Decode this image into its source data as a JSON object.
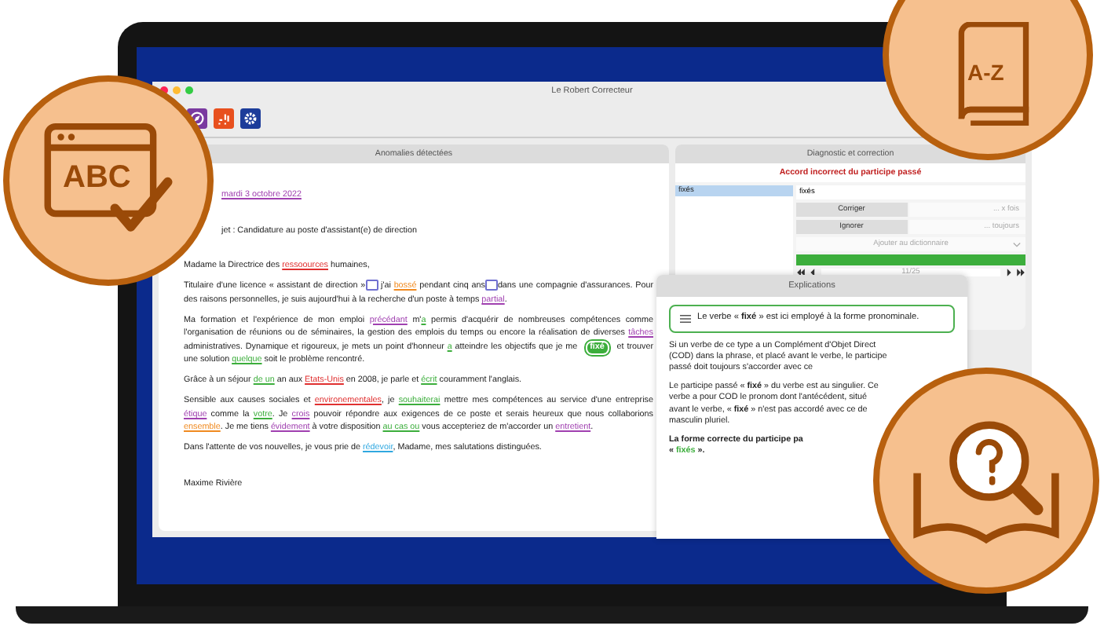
{
  "window": {
    "title": "Le Robert Correcteur"
  },
  "badges": {
    "top_left": "ABC",
    "top_right": "A-Z"
  },
  "anomalies": {
    "title": "Anomalies détectées",
    "paragraphs": [
      {
        "kind": "heading",
        "segments": [
          {
            "text": "mardi 3 octobre 2022",
            "color": "#a040b0"
          }
        ]
      },
      {
        "kind": "heading",
        "segments": [
          {
            "text": "jet : Candidature au poste d'assistant(e) de direction"
          }
        ]
      },
      {
        "kind": "body",
        "segments": [
          {
            "text": "Madame la Directrice des "
          },
          {
            "text": "ressoources",
            "color": "#e03030"
          },
          {
            "text": " humaines,"
          }
        ]
      },
      {
        "kind": "body",
        "segments": [
          {
            "text": "Titulaire d'une licence « assistant de direction »"
          },
          {
            "kind": "space",
            "color": "#7070d0"
          },
          {
            "text": " j'ai "
          },
          {
            "text": "bossé",
            "color": "#f08a20"
          },
          {
            "text": " pendant cinq ans"
          },
          {
            "kind": "space",
            "color": "#7070d0"
          },
          {
            "text": "dans une compagnie d'assurances. Pour des raisons personnelles, je suis aujourd'hui à la recherche d'un poste à temps "
          },
          {
            "text": "partial",
            "color": "#a040b0"
          },
          {
            "text": "."
          }
        ]
      },
      {
        "kind": "body",
        "segments": [
          {
            "text": "Ma formation et l'expérience de mon emploi "
          },
          {
            "text": "précédant",
            "color": "#a040b0"
          },
          {
            "text": " m'"
          },
          {
            "text": "a",
            "color": "#3cae3c"
          },
          {
            "text": " permis d'acquérir de nombreuses compétences comme l'organisation de réunions ou de séminaires, la gestion des emplois du temps ou encore la réalisation de diverses "
          },
          {
            "text": "tâches",
            "color": "#a040b0"
          },
          {
            "text": " administratives. Dynamique et rigoureux, je mets un point d'honneur "
          },
          {
            "text": "a",
            "color": "#3cae3c"
          },
          {
            "text": " atteindre les objectifs que je me "
          },
          {
            "kind": "focus",
            "text": "fixé",
            "color": "#3cae3c"
          },
          {
            "text": " et trouver une solution "
          },
          {
            "text": "quelque",
            "color": "#3cae3c"
          },
          {
            "text": " soit le problème rencontré."
          }
        ]
      },
      {
        "kind": "body",
        "segments": [
          {
            "text": "Grâce à un séjour "
          },
          {
            "text": "de un",
            "color": "#3cae3c"
          },
          {
            "text": " an aux "
          },
          {
            "text": "Etats-Unis",
            "color": "#e03030"
          },
          {
            "text": " en 2008, je parle et "
          },
          {
            "text": "écrit",
            "color": "#3cae3c"
          },
          {
            "text": " couramment l'anglais."
          }
        ]
      },
      {
        "kind": "body",
        "segments": [
          {
            "text": "Sensible aux causes sociales et "
          },
          {
            "text": "environementales",
            "color": "#e03030"
          },
          {
            "text": ", je "
          },
          {
            "text": "souhaiterai",
            "color": "#3cae3c"
          },
          {
            "text": " mettre mes compétences au service d'une entreprise "
          },
          {
            "text": "étique",
            "color": "#a040b0"
          },
          {
            "text": " comme la "
          },
          {
            "text": "votre",
            "color": "#3cae3c"
          },
          {
            "text": ". Je "
          },
          {
            "text": "crois",
            "color": "#a040b0"
          },
          {
            "text": " pouvoir répondre aux exigences de ce poste et serais heureux que nous collaborions "
          },
          {
            "text": "ensemble",
            "color": "#f08a20"
          },
          {
            "text": ". Je me tiens "
          },
          {
            "text": "évidement",
            "color": "#a040b0"
          },
          {
            "text": " à votre disposition "
          },
          {
            "text": "au cas ou",
            "color": "#3cae3c"
          },
          {
            "text": " vous accepteriez de m'accorder un "
          },
          {
            "text": "entretient",
            "color": "#a040b0"
          },
          {
            "text": "."
          }
        ]
      },
      {
        "kind": "body",
        "segments": [
          {
            "text": "Dans l'attente de vos nouvelles, je vous prie de "
          },
          {
            "text": "rédevoir",
            "color": "#30a8e0"
          },
          {
            "text": ", Madame, mes salutations distinguées."
          }
        ]
      },
      {
        "kind": "signature",
        "segments": [
          {
            "text": "Maxime Rivière"
          }
        ]
      }
    ]
  },
  "diagnostic": {
    "title": "Diagnostic et correction",
    "error": "Accord incorrect du participe passé",
    "suggestions": [
      {
        "label": "fixés",
        "selected": true
      }
    ],
    "correction": "fixés",
    "correct_button": "Corriger",
    "correct_times": "... x fois",
    "ignore_button": "Ignorer",
    "ignore_times": "... toujours",
    "dictionary": "Ajouter au dictionnaire",
    "level": 1,
    "counter": "11/25"
  },
  "explanations": {
    "title": "Explications",
    "rule": "Le verbe « **fixé** » est ici employé à la forme pronominale.",
    "paragraphs": [
      "Si un verbe de ce type a un Complément d'Objet Direct (COD) dans la phrase, et placé avant le verbe, le participe passé doit toujours s'accorder avec ce",
      "Le participe passé « **fixé** » du verbe est au singulier. Ce verbe a pour COD le pronom dont l'antécédent, situé avant le verbe, « **fixé** » n'est pas accordé avec ce de masculin pluriel."
    ],
    "conclusion": {
      "lead": "La forme correcte du participe pa",
      "open": "«",
      "answer": "fixés",
      "close": "»."
    }
  }
}
